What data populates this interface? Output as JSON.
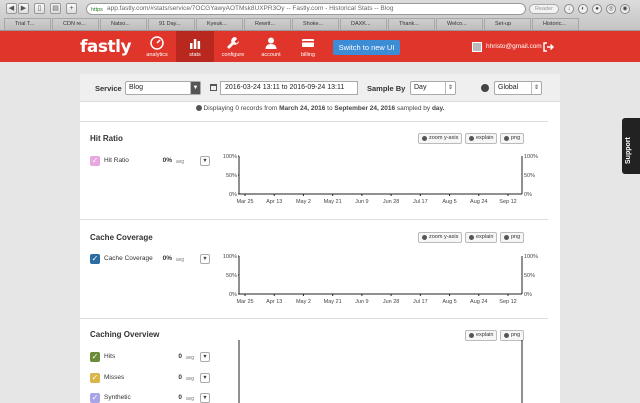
{
  "browser": {
    "url": "app.fastly.com/#stats/service/7OCGYawyAOTMsk8UXPR3Oy -- Fastly.com - Historical Stats -- Blog",
    "url_scheme": "https",
    "reader_label": "Reader",
    "tabs": [
      "Trial T...",
      "CDN re...",
      "Natso...",
      "91 Day...",
      "Kyeuk...",
      "Rewrit...",
      "Shoke...",
      "DAXK...",
      "Thank...",
      "Welco...",
      "Set-up",
      "Historic..."
    ]
  },
  "nav": {
    "logo": "fastly",
    "items": [
      {
        "label": "analytics",
        "icon": "gauge-icon"
      },
      {
        "label": "stats",
        "icon": "bar-chart-icon"
      },
      {
        "label": "configure",
        "icon": "wrench-icon"
      },
      {
        "label": "account",
        "icon": "user-icon"
      },
      {
        "label": "billing",
        "icon": "credit-card-icon"
      }
    ],
    "active": "stats",
    "switch_button": "Switch to new UI",
    "user_email": "hhristo@gmail.com"
  },
  "support_label": "Support",
  "filters": {
    "service_label": "Service",
    "service_value": "Blog",
    "date_range": "2016-03-24 13:11 to 2016-09-24 13:11",
    "sample_by_label": "Sample By",
    "sample_by_value": "Day",
    "region_value": "Global"
  },
  "info": {
    "pre": "Displaying",
    "count": "0",
    "mid1": "records from",
    "from": "March 24, 2016",
    "mid2": "to",
    "to": "September 24, 2016",
    "mid3": "sampled by",
    "sample": "day."
  },
  "toolbar": {
    "zoom": "zoom y-axis",
    "explain": "explain",
    "png": "png"
  },
  "sections": [
    {
      "title": "Hit Ratio",
      "metrics": [
        {
          "label": "Hit Ratio",
          "value": "0%",
          "avg": "avg",
          "color": "#e8a7e0"
        }
      ],
      "chart_data": {
        "type": "line",
        "y_ticks": [
          "100%",
          "50%",
          "0%"
        ],
        "x_ticks": [
          "Mar 25",
          "Apr 13",
          "May 2",
          "May 21",
          "Jun 9",
          "Jun 28",
          "Jul 17",
          "Aug 5",
          "Aug 24",
          "Sep 12"
        ],
        "series": []
      }
    },
    {
      "title": "Cache Coverage",
      "metrics": [
        {
          "label": "Cache Coverage",
          "value": "0%",
          "avg": "avg",
          "color": "#2b6ca3"
        }
      ],
      "chart_data": {
        "type": "line",
        "y_ticks": [
          "100%",
          "50%",
          "0%"
        ],
        "x_ticks": [
          "Mar 25",
          "Apr 13",
          "May 2",
          "May 21",
          "Jun 9",
          "Jun 28",
          "Jul 17",
          "Aug 5",
          "Aug 24",
          "Sep 12"
        ],
        "series": []
      }
    },
    {
      "title": "Caching Overview",
      "metrics": [
        {
          "label": "Hits",
          "value": "0",
          "avg": "avg",
          "color": "#6b8c3a"
        },
        {
          "label": "Misses",
          "value": "0",
          "avg": "avg",
          "color": "#d9b54a"
        },
        {
          "label": "Synthetic",
          "value": "0",
          "avg": "avg",
          "color": "#a7a4e8"
        }
      ]
    }
  ]
}
